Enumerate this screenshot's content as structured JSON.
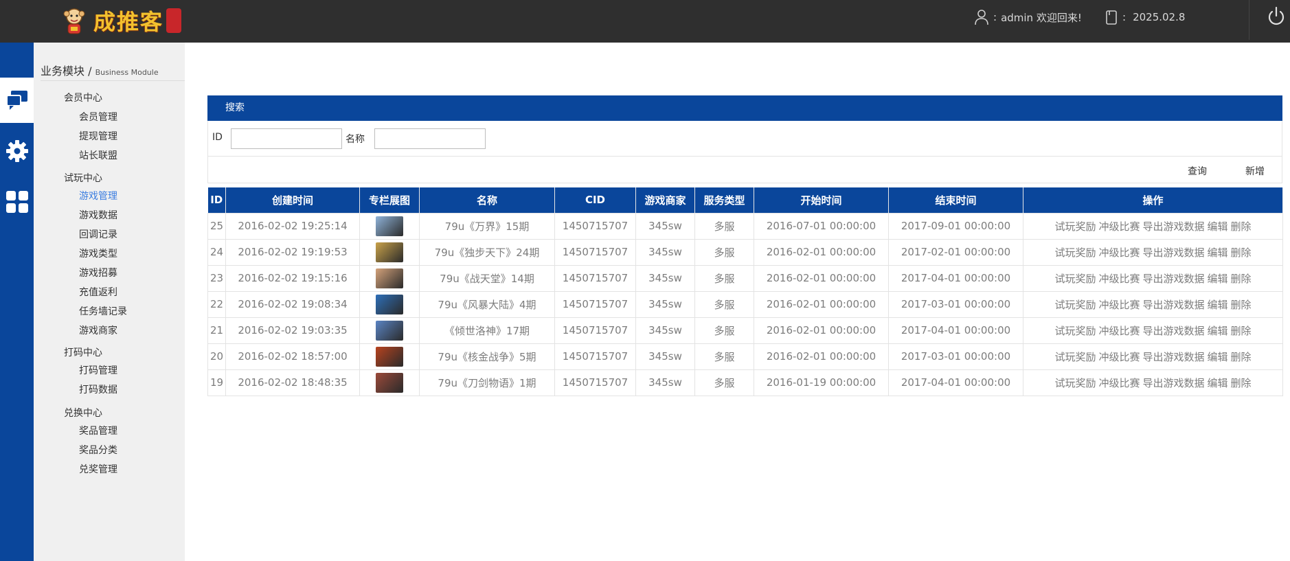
{
  "header": {
    "logo_text": "成推客",
    "user_sep": ":",
    "user_text": "admin 欢迎回来!",
    "date_sep": ":",
    "date_text": "2025.02.8"
  },
  "sidebar": {
    "title": "业务模块",
    "title_sep": "/",
    "title_sub": "Business Module",
    "groups": [
      {
        "title": "会员中心",
        "items": [
          "会员管理",
          "提现管理",
          "站长联盟"
        ]
      },
      {
        "title": "试玩中心",
        "items": [
          "游戏管理",
          "游戏数据",
          "回调记录",
          "游戏类型",
          "游戏招募",
          "充值返利",
          "任务墙记录",
          "游戏商家"
        ]
      },
      {
        "title": "打码中心",
        "items": [
          "打码管理",
          "打码数据"
        ]
      },
      {
        "title": "兑换中心",
        "items": [
          "奖品管理",
          "奖品分类",
          "兑奖管理"
        ]
      }
    ],
    "active_item": "游戏管理"
  },
  "panel": {
    "title": "搜索"
  },
  "search": {
    "id_label": "ID",
    "name_label": "名称",
    "id_value": "",
    "name_value": ""
  },
  "actions": {
    "query": "查询",
    "add": "新增"
  },
  "table": {
    "headers": [
      "ID",
      "创建时间",
      "专栏展图",
      "名称",
      "CID",
      "游戏商家",
      "服务类型",
      "开始时间",
      "结束时间",
      "操作"
    ],
    "rows": [
      {
        "id": "25",
        "created": "2016-02-02 19:25:14",
        "thumb_color": "#8fb3d9",
        "name": "79u《万界》15期",
        "cid": "1450715707",
        "merchant": "345sw",
        "service": "多服",
        "start": "2016-07-01 00:00:00",
        "end": "2017-09-01 00:00:00"
      },
      {
        "id": "24",
        "created": "2016-02-02 19:19:53",
        "thumb_color": "#c9a24a",
        "name": "79u《独步天下》24期",
        "cid": "1450715707",
        "merchant": "345sw",
        "service": "多服",
        "start": "2016-02-01 00:00:00",
        "end": "2017-02-01 00:00:00"
      },
      {
        "id": "23",
        "created": "2016-02-02 19:15:16",
        "thumb_color": "#d4a27a",
        "name": "79u《战天堂》14期",
        "cid": "1450715707",
        "merchant": "345sw",
        "service": "多服",
        "start": "2016-02-01 00:00:00",
        "end": "2017-04-01 00:00:00"
      },
      {
        "id": "22",
        "created": "2016-02-02 19:08:34",
        "thumb_color": "#2e6fb8",
        "name": "79u《风暴大陆》4期",
        "cid": "1450715707",
        "merchant": "345sw",
        "service": "多服",
        "start": "2016-02-01 00:00:00",
        "end": "2017-03-01 00:00:00"
      },
      {
        "id": "21",
        "created": "2016-02-02 19:03:35",
        "thumb_color": "#5a84c4",
        "name": "《倾世洛神》17期",
        "cid": "1450715707",
        "merchant": "345sw",
        "service": "多服",
        "start": "2016-02-01 00:00:00",
        "end": "2017-04-01 00:00:00"
      },
      {
        "id": "20",
        "created": "2016-02-02 18:57:00",
        "thumb_color": "#b8431f",
        "name": "79u《核金战争》5期",
        "cid": "1450715707",
        "merchant": "345sw",
        "service": "多服",
        "start": "2016-02-01 00:00:00",
        "end": "2017-03-01 00:00:00"
      },
      {
        "id": "19",
        "created": "2016-02-02 18:48:35",
        "thumb_color": "#9b4a3a",
        "name": "79u《刀剑物语》1期",
        "cid": "1450715707",
        "merchant": "345sw",
        "service": "多服",
        "start": "2016-01-19 00:00:00",
        "end": "2017-04-01 00:00:00"
      }
    ],
    "row_ops": [
      "试玩奖励",
      "冲级比赛",
      "导出游戏数据",
      "编辑",
      "删除"
    ]
  },
  "colors": {
    "brand": "#0a469b",
    "header_bg": "#2f2f2f",
    "active_link": "#3b7de0"
  },
  "icons": [
    "user-icon",
    "calendar-icon",
    "power-icon",
    "chat-icon",
    "gear-icon",
    "grid-icon"
  ]
}
